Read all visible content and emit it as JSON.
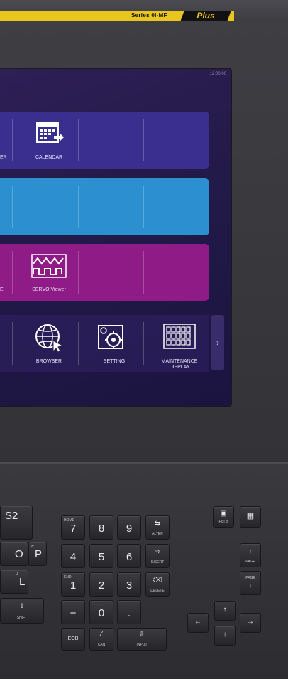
{
  "header": {
    "series_label": "Series 0i-MF",
    "plus_label": "Plus"
  },
  "screen": {
    "clock": "12:00:00",
    "row1": {
      "frag_left": "ER",
      "calendar_label": "CALENDAR"
    },
    "row3": {
      "frag_left": "E",
      "servo_label": "SERVO Viewer"
    },
    "row4": {
      "browser_label": "BROWSER",
      "setting_label": "SETTING",
      "maintenance_label": "MAINTENANCE DISPLAY",
      "next_arrow": "›"
    },
    "colors": {
      "row1": "#3a2e8f",
      "row2": "#2c8fcf",
      "row3": "#8e1b86"
    }
  },
  "keypad": {
    "s2": "S2",
    "o_key": "O",
    "o_sub": "Q",
    "p_key": "P",
    "p_sub": "W",
    "l_key": "L",
    "l_sub": "J",
    "shift": "SHIFT",
    "n7": "7",
    "n7_sub": "HOME",
    "n8": "8",
    "n9": "9",
    "n4": "4",
    "n5": "5",
    "n6": "6",
    "n1": "1",
    "n1_sub": "END",
    "n2": "2",
    "n3": "3",
    "minus": "−",
    "zero": "0",
    "dot": ".",
    "eob": "EOB",
    "can": "CAN",
    "input": "INPUT",
    "alter": "ALTER",
    "insert": "INSERT",
    "delete": "DELETE",
    "help": "HELP",
    "page_up": "PAGE",
    "page_down": "PAGE"
  }
}
